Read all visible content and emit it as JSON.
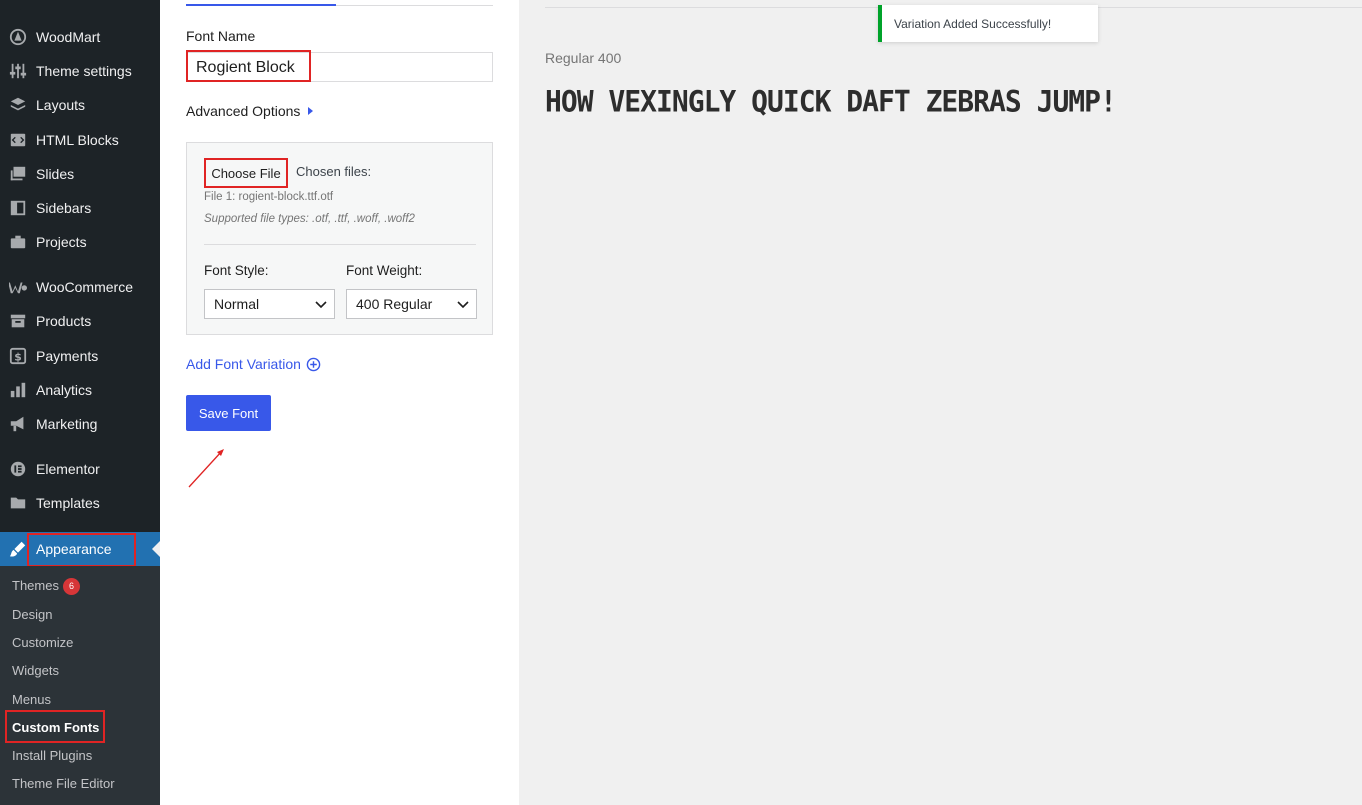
{
  "sidebar": {
    "items": [
      {
        "label": "WoodMart",
        "icon": "woodmart-icon"
      },
      {
        "label": "Theme settings",
        "icon": "sliders-icon"
      },
      {
        "label": "Layouts",
        "icon": "layers-icon"
      },
      {
        "label": "HTML Blocks",
        "icon": "code-block-icon"
      },
      {
        "label": "Slides",
        "icon": "slides-icon"
      },
      {
        "label": "Sidebars",
        "icon": "sidebar-icon"
      },
      {
        "label": "Projects",
        "icon": "briefcase-icon"
      },
      {
        "label": "WooCommerce",
        "icon": "woocommerce-icon"
      },
      {
        "label": "Products",
        "icon": "archive-icon"
      },
      {
        "label": "Payments",
        "icon": "dollar-icon"
      },
      {
        "label": "Analytics",
        "icon": "bar-chart-icon"
      },
      {
        "label": "Marketing",
        "icon": "megaphone-icon"
      },
      {
        "label": "Elementor",
        "icon": "elementor-icon"
      },
      {
        "label": "Templates",
        "icon": "folder-icon"
      }
    ],
    "active": {
      "label": "Appearance",
      "icon": "paintbrush-icon"
    },
    "submenu": [
      {
        "label": "Themes",
        "badge": "6"
      },
      {
        "label": "Design"
      },
      {
        "label": "Customize"
      },
      {
        "label": "Widgets"
      },
      {
        "label": "Menus"
      },
      {
        "label": "Custom Fonts"
      },
      {
        "label": "Install Plugins"
      },
      {
        "label": "Theme File Editor"
      }
    ]
  },
  "editor": {
    "font_name_label": "Font Name",
    "font_name_value": "Rogient Block",
    "advanced_label": "Advanced Options",
    "choose_file_label": "Choose File",
    "chosen_files_label": "Chosen files:",
    "file_line": "File 1: rogient-block.ttf.otf",
    "supported_types": "Supported file types: .otf, .ttf, .woff, .woff2",
    "font_style_label": "Font Style:",
    "font_style_value": "Normal",
    "font_weight_label": "Font Weight:",
    "font_weight_value": "400 Regular",
    "add_variation_label": "Add Font Variation",
    "save_label": "Save Font"
  },
  "preview": {
    "weight_label": "Regular 400",
    "sample_text": "How vexingly quick daft zebras jump!"
  },
  "toast": {
    "message": "Variation Added Successfully!",
    "color": "#00a32a"
  },
  "colors": {
    "accent": "#3858e9",
    "sidebar_bg": "#1d2327",
    "active_bg": "#2271b1",
    "highlight": "#e02424"
  }
}
